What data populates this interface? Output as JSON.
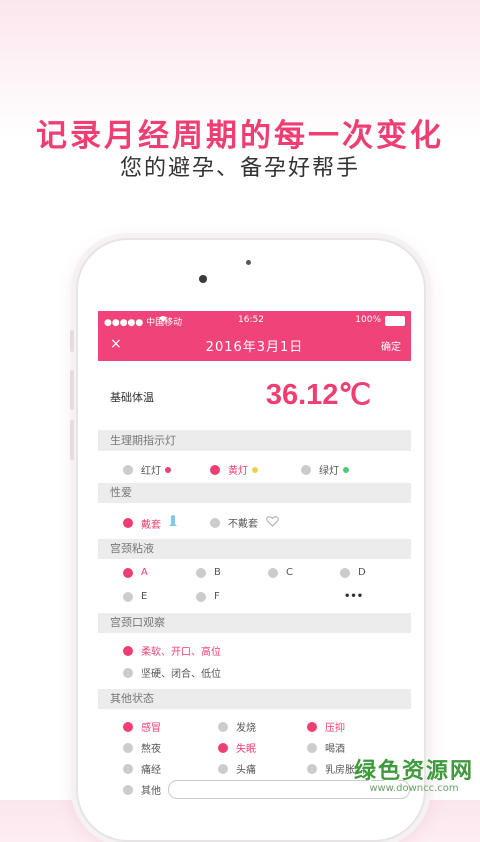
{
  "promo": {
    "headline": "记录月经周期的每一次变化",
    "subheadline": "您的避孕、备孕好帮手"
  },
  "status_bar": {
    "carrier": "●●●●● 中国移动",
    "time": "16:52",
    "battery": "100%"
  },
  "title_bar": {
    "close_icon": "×",
    "date": "2016年3月1日",
    "confirm": "确定"
  },
  "temperature": {
    "label": "基础体温",
    "value": "36.12℃"
  },
  "sections": {
    "light": "生理期指示灯",
    "sex": "性爱",
    "mucus": "宫颈粘液",
    "cervix": "宫颈口观察",
    "other": "其他状态"
  },
  "light_options": [
    "红灯",
    "黄灯",
    "绿灯"
  ],
  "sex_options": [
    "戴套",
    "不戴套"
  ],
  "mucus_options": [
    "A",
    "B",
    "C",
    "D",
    "E",
    "F"
  ],
  "mucus_more": "•••",
  "cervix_options": [
    "柔软、开口、高位",
    "坚硬、闭合、低位"
  ],
  "other_options": [
    "感冒",
    "发烧",
    "压抑",
    "熬夜",
    "失眠",
    "喝酒",
    "痛经",
    "头痛",
    "乳房胀痛",
    "其他"
  ],
  "colors": {
    "accent": "#f0437a",
    "red_light": "#ee3e72",
    "yellow_light": "#f2d04b",
    "green_light": "#4fc97a"
  },
  "watermark": {
    "main": "绿色资源网",
    "sub": "www.downcc.com"
  }
}
